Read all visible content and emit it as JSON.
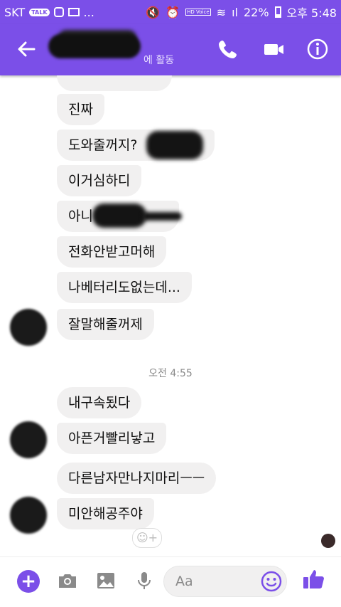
{
  "status_bar": {
    "carrier": "SKT",
    "talk_badge": "TALK",
    "more": "...",
    "hd_voice": "HD Voice",
    "signal": "ıl",
    "battery_percent": "22%",
    "time": "오후 5:48"
  },
  "header": {
    "subtitle_visible": "에 활동"
  },
  "messages_group1": [
    "진짜",
    "도와줄꺼지?",
    "이거심하디",
    "아니",
    "전화안받고머해",
    "나베터리도없는데...",
    "잘말해줄꺼제"
  ],
  "timestamp": "오전 4:55",
  "messages_group2": [
    "내구속됬다",
    "아픈거빨리낳고",
    "다른남자만나지마리ㅡㅡ",
    "미안해공주야"
  ],
  "composer": {
    "placeholder": "Aa"
  },
  "colors": {
    "accent": "#7b4fe8",
    "bubble": "#f1f0f0"
  },
  "icons": [
    "back-arrow-icon",
    "phone-icon",
    "video-icon",
    "info-icon",
    "plus-icon",
    "camera-icon",
    "image-icon",
    "mic-icon",
    "smile-icon",
    "thumbs-up-icon",
    "add-reaction-icon"
  ]
}
